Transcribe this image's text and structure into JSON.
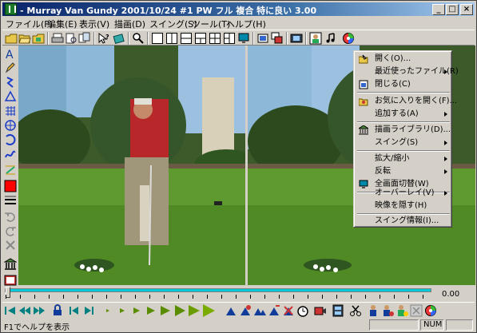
{
  "window": {
    "title": "- Murray Van Gundy   2001/10/24   #1   PW  フル   複合   特に良い   3.00",
    "minimize_glyph": "_",
    "maximize_glyph": "□",
    "close_glyph": "×"
  },
  "menubar": {
    "items": [
      {
        "label": "ファイル(F)"
      },
      {
        "label": "編集(E)"
      },
      {
        "label": "表示(V)"
      },
      {
        "label": "描画(D)"
      },
      {
        "label": "スイング(S)"
      },
      {
        "label": "ツール(T)"
      },
      {
        "label": "ヘルプ(H)"
      }
    ]
  },
  "context_menu": {
    "items": [
      {
        "label": "開く(O)...",
        "icon": "open-folder-icon",
        "submenu": false
      },
      {
        "label": "最近使ったファイル(R)",
        "icon": "",
        "submenu": true
      },
      {
        "label": "閉じる(C)",
        "icon": "close-doc-icon",
        "submenu": false
      },
      {
        "label": "お気に入りを開く(F)...",
        "icon": "favorites-folder-icon",
        "submenu": false
      },
      {
        "label": "追加する(A)",
        "icon": "",
        "submenu": true
      },
      {
        "label": "描画ライブラリ(D)...",
        "icon": "library-icon",
        "submenu": false
      },
      {
        "label": "スイング(S)",
        "icon": "",
        "submenu": true
      },
      {
        "label": "拡大/縮小",
        "icon": "",
        "submenu": true
      },
      {
        "label": "反転",
        "icon": "",
        "submenu": true
      },
      {
        "label": "全画面切替(W)",
        "icon": "monitor-icon",
        "submenu": false
      },
      {
        "label": "オーバーレイ(V)",
        "icon": "",
        "submenu": true
      },
      {
        "label": "映像を隠す(H)",
        "icon": "",
        "submenu": false
      },
      {
        "label": "スイング情報(I)...",
        "icon": "",
        "submenu": false
      }
    ]
  },
  "timeline": {
    "time_value": "0.00",
    "position": 0
  },
  "statusbar": {
    "help_text": "F1でヘルプを表示",
    "num_indicator": "NUM"
  },
  "colors": {
    "title_gradient_start": "#0a246a",
    "title_gradient_end": "#a6caf0",
    "window_face": "#d4d0c8",
    "timeline_track": "#00c8d8",
    "play_green": "#5a8c00",
    "nav_teal": "#008080"
  }
}
